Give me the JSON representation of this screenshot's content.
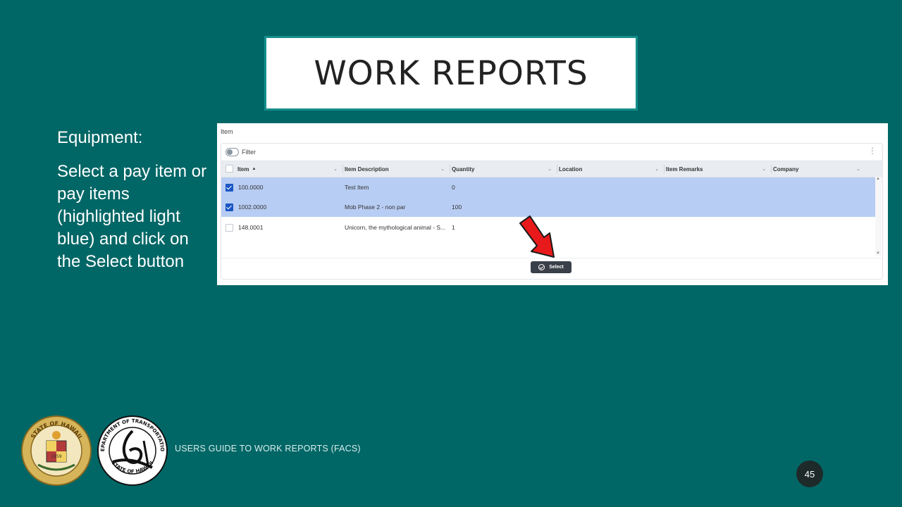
{
  "title": "WORK REPORTS",
  "instructions": {
    "heading": "Equipment:",
    "body": "Select a pay item or pay items (highlighted light blue) and click on the Select button"
  },
  "screenshot": {
    "panel_title": "Item",
    "filter_label": "Filter",
    "columns": [
      "Item",
      "Item Description",
      "Quantity",
      "Location",
      "Item Remarks",
      "Company"
    ],
    "sort_indicator": "▲",
    "rows": [
      {
        "item": "100.0000",
        "description": "Test Item",
        "quantity": "0",
        "location": "",
        "remarks": "",
        "company": "",
        "selected": true
      },
      {
        "item": "1002.0000",
        "description": "Mob Phase 2 - non par",
        "quantity": "100",
        "location": "",
        "remarks": "",
        "company": "",
        "selected": true
      },
      {
        "item": "148.0001",
        "description": "Unicorn, the mythological animal - S...",
        "quantity": "1",
        "location": "",
        "remarks": "",
        "company": "",
        "selected": false
      }
    ],
    "select_button_label": "Select"
  },
  "footer": {
    "guide_text": "USERS GUIDE TO WORK REPORTS  (FACS)",
    "page_number": "45",
    "seal_left": {
      "text_top": "STATE OF HAWAII",
      "year": "1959"
    },
    "seal_right": {
      "text_top": "DEPARTMENT OF TRANSPORTATION",
      "text_bottom": "STATE OF HAWAII"
    }
  },
  "colors": {
    "background": "#006766",
    "title_border": "#158f8b",
    "selection": "#b8cdf3",
    "checkbox": "#1a56c4",
    "arrow": "#e8191a"
  }
}
